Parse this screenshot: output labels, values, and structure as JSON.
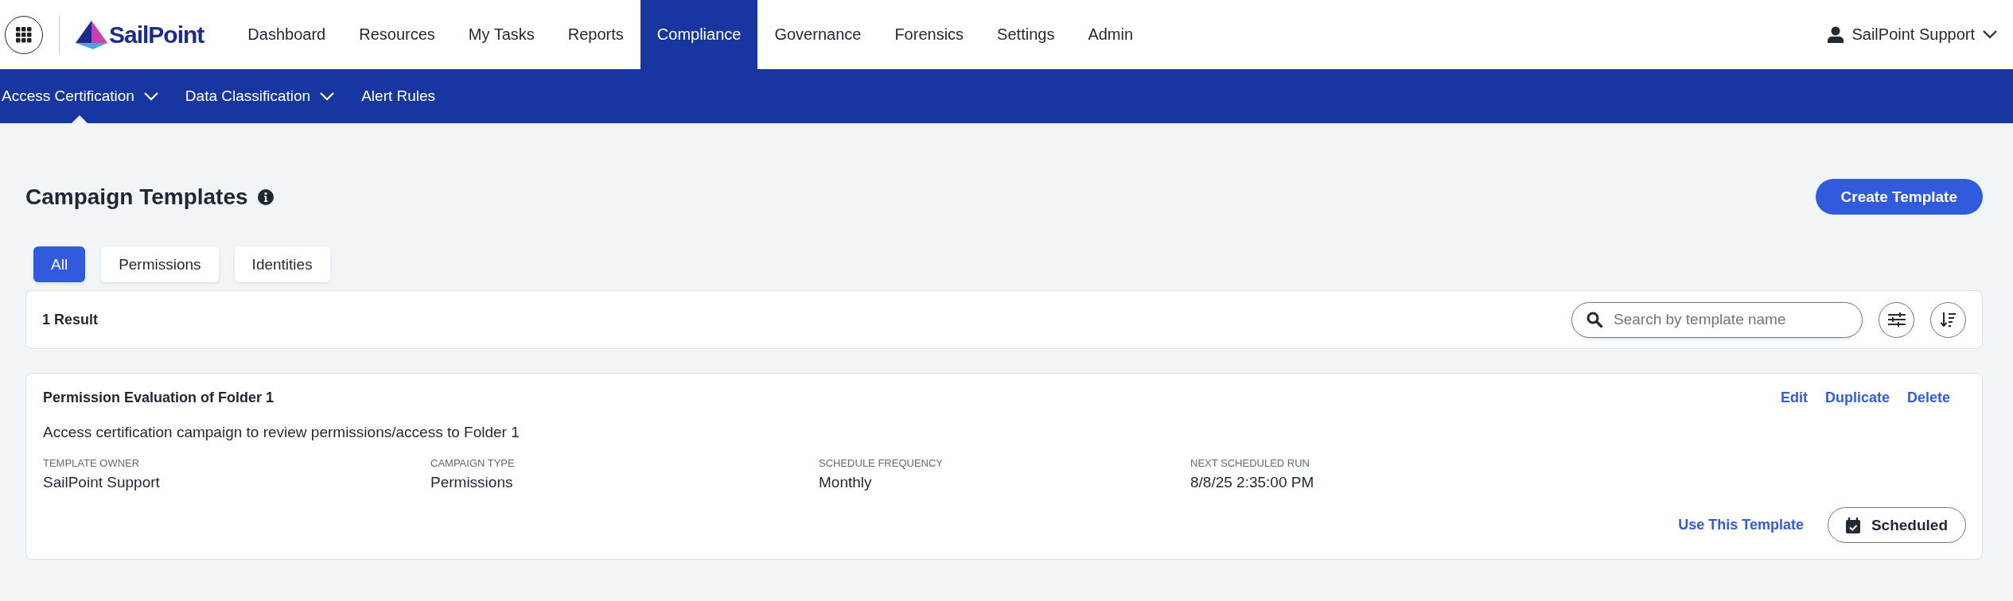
{
  "logo": {
    "text": "SailPoint"
  },
  "nav": [
    {
      "label": "Dashboard",
      "selected": false
    },
    {
      "label": "Resources",
      "selected": false
    },
    {
      "label": "My Tasks",
      "selected": false
    },
    {
      "label": "Reports",
      "selected": false
    },
    {
      "label": "Compliance",
      "selected": true
    },
    {
      "label": "Governance",
      "selected": false
    },
    {
      "label": "Forensics",
      "selected": false
    },
    {
      "label": "Settings",
      "selected": false
    },
    {
      "label": "Admin",
      "selected": false
    }
  ],
  "user": {
    "name": "SailPoint Support"
  },
  "subnav": [
    {
      "label": "Access Certification",
      "has_menu": true,
      "selected": true
    },
    {
      "label": "Data Classification",
      "has_menu": true,
      "selected": false
    },
    {
      "label": "Alert Rules",
      "has_menu": false,
      "selected": false
    }
  ],
  "page": {
    "title": "Campaign Templates",
    "create_button": "Create Template"
  },
  "filters": [
    {
      "label": "All",
      "selected": true
    },
    {
      "label": "Permissions",
      "selected": false
    },
    {
      "label": "Identities",
      "selected": false
    }
  ],
  "results": {
    "count": "1 Result",
    "search": {
      "placeholder": "Search by template name"
    }
  },
  "templates": [
    {
      "name": "Permission Evaluation of Folder 1",
      "description": "Access certification campaign to review permissions/access to Folder 1",
      "actions": [
        "Edit",
        "Duplicate",
        "Delete"
      ],
      "fields": [
        {
          "label": "TEMPLATE OWNER",
          "value": "SailPoint Support"
        },
        {
          "label": "CAMPAIGN TYPE",
          "value": "Permissions"
        },
        {
          "label": "SCHEDULE FREQUENCY",
          "value": "Monthly"
        },
        {
          "label": "NEXT SCHEDULED RUN",
          "value": "8/8/25 2:35:00 PM"
        }
      ],
      "use_link": "Use This Template",
      "status": "Scheduled"
    }
  ]
}
